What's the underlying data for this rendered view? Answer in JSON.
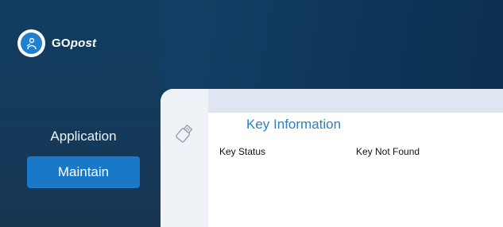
{
  "brand": {
    "name_prefix": "GO",
    "name_suffix": "post",
    "logo_icon": "gopost-logo-icon"
  },
  "sidebar": {
    "items": [
      {
        "label": "Application",
        "selected": false
      },
      {
        "label": "Maintain",
        "selected": true
      }
    ]
  },
  "content": {
    "tab_icon": "usb-key-icon",
    "section_title": "Key Information",
    "rows": [
      {
        "label": "Key Status",
        "value": "Key Not Found"
      }
    ]
  },
  "colors": {
    "sidebar_bg": "#123e61",
    "selected_item_bg": "#1a78c8",
    "section_title": "#2f7fc6",
    "content_bg": "#ffffff"
  }
}
